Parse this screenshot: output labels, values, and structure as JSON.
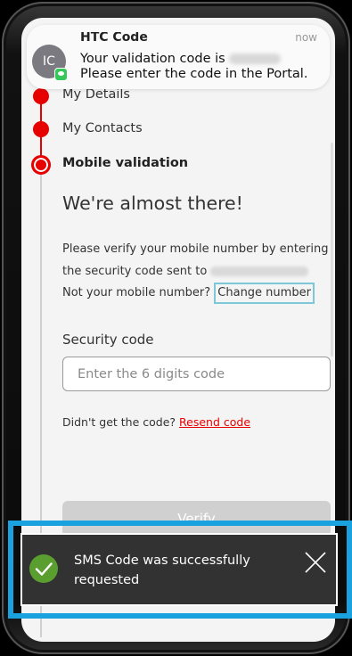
{
  "notification": {
    "avatar_initials": "IC",
    "sender": "HTC Code",
    "time": "now",
    "message_prefix": "Your validation code is",
    "message_suffix": "Please enter the code in the Portal."
  },
  "steps": [
    {
      "label": "My Details"
    },
    {
      "label": "My Contacts"
    },
    {
      "label": "Mobile validation",
      "active": true
    }
  ],
  "form": {
    "heading": "We're almost there!",
    "instructions": "Please verify your mobile number by entering the security code sent to",
    "not_your_number": "Not your mobile number?",
    "change_number": "Change number",
    "security_label": "Security code",
    "security_placeholder": "Enter the 6 digits code",
    "resend_prompt": "Didn't get the code?",
    "resend_link": "Resend code",
    "verify_button": "Verify"
  },
  "toast": {
    "message": "SMS Code was successfully requested",
    "icon": "check-circle-icon",
    "close_icon": "close-icon"
  },
  "colors": {
    "accent": "#e60000",
    "toast_bg": "#323232",
    "highlight": "#1aa1e0",
    "success": "#5a9e2f"
  }
}
